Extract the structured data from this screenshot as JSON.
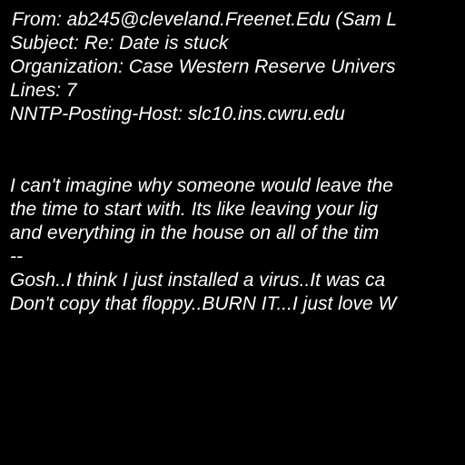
{
  "message": {
    "headers": {
      "from": "From: ab245@cleveland.Freenet.Edu (Sam L",
      "subject": "Subject: Re: Date is stuck",
      "organization": "Organization: Case Western Reserve Univers",
      "lines": "Lines: 7",
      "nntp_posting_host": "NNTP-Posting-Host: slc10.ins.cwru.edu"
    },
    "body": [
      "I can't imagine why someone would leave the",
      "the time to start with. Its like leaving your lig",
      "and everything in the house on all of the tim"
    ],
    "signature_separator": "--",
    "signature": [
      "Gosh..I think I just installed a virus..It was ca",
      "Don't copy that floppy..BURN IT...I just love W"
    ]
  },
  "colors": {
    "background": "#000000",
    "text": "#ffffff"
  }
}
